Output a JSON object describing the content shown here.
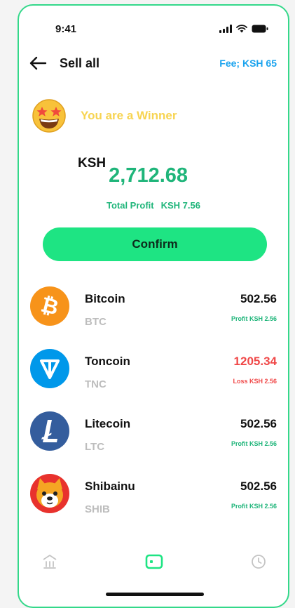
{
  "status": {
    "time": "9:41"
  },
  "header": {
    "title": "Sell all",
    "fee": "Fee; KSH 65"
  },
  "winner": {
    "text": "You are a Winner"
  },
  "amount": {
    "currency": "KSH",
    "value": "2,712.68"
  },
  "profit": {
    "label": "Total Profit",
    "value": "KSH 7.56"
  },
  "confirm": {
    "label": "Confirm"
  },
  "coins": [
    {
      "name": "Bitcoin",
      "symbol": "BTC",
      "value": "502.56",
      "pl": "Profit KSH 2.56",
      "type": "profit",
      "icon": "bitcoin-icon",
      "color": "#f7931a"
    },
    {
      "name": "Toncoin",
      "symbol": "TNC",
      "value": "1205.34",
      "pl": "Loss KSH 2.56",
      "type": "loss",
      "icon": "toncoin-icon",
      "color": "#0098ea"
    },
    {
      "name": "Litecoin",
      "symbol": "LTC",
      "value": "502.56",
      "pl": "Profit KSH 2.56",
      "type": "profit",
      "icon": "litecoin-icon",
      "color": "#345d9d"
    },
    {
      "name": "Shibainu",
      "symbol": "SHIB",
      "value": "502.56",
      "pl": "Profit KSH 2.56",
      "type": "profit",
      "icon": "shibainu-icon",
      "color": "#f5a623"
    }
  ],
  "tabs": [
    {
      "name": "bank-icon"
    },
    {
      "name": "wallet-icon",
      "active": true
    },
    {
      "name": "history-icon"
    }
  ],
  "colors": {
    "accent": "#1ee483",
    "profit": "#1fb57a",
    "loss": "#f04848",
    "fee": "#1aa3ee",
    "winner": "#f7d451",
    "frame": "#34d88a"
  }
}
